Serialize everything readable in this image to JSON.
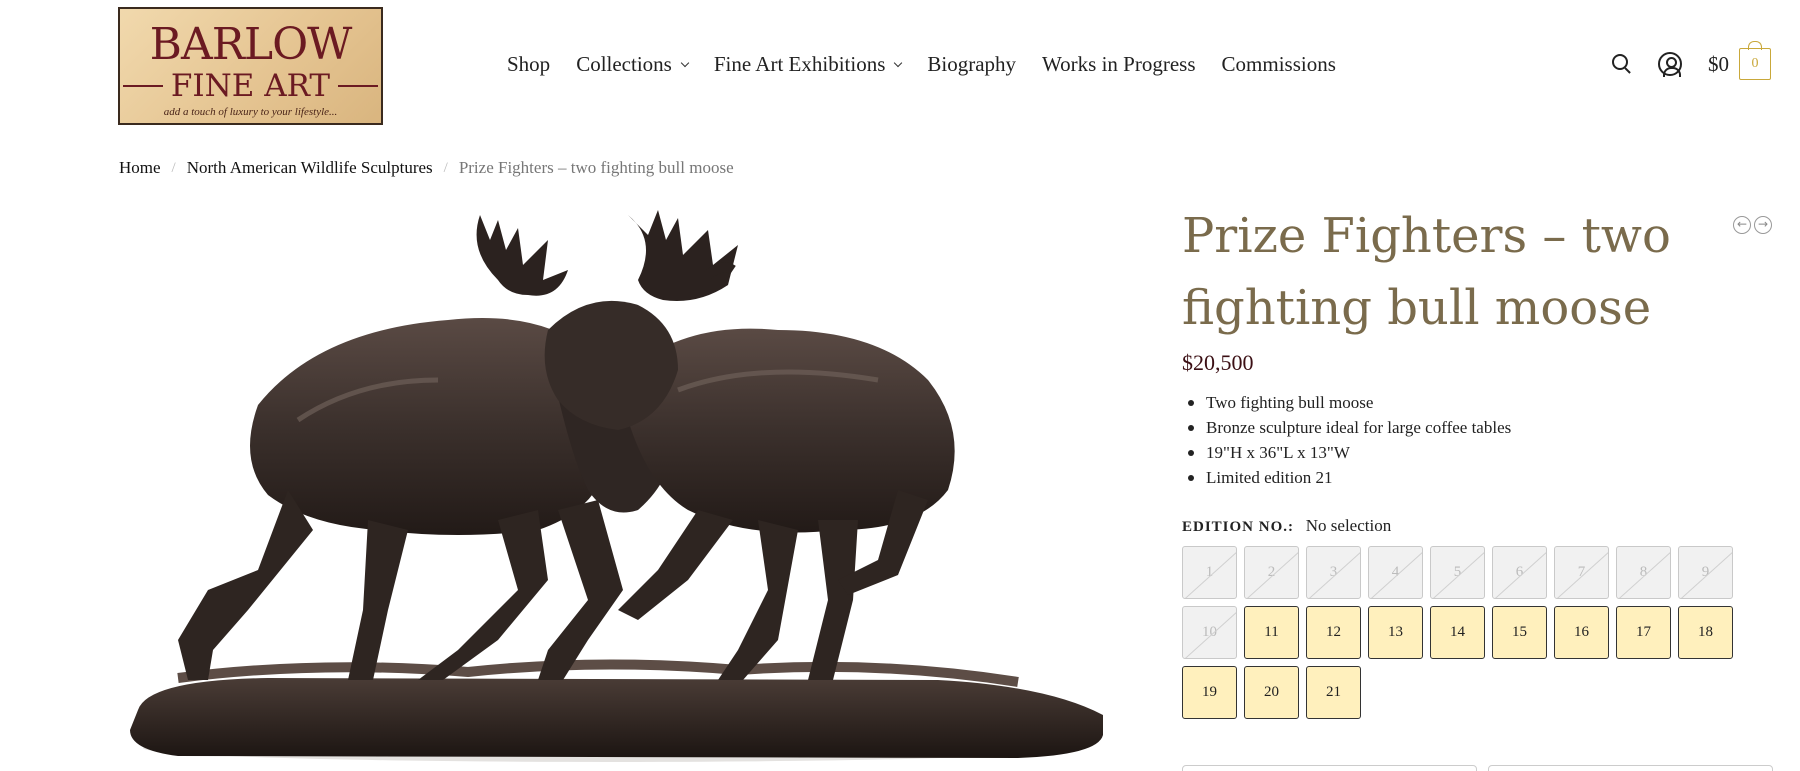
{
  "logo": {
    "line1": "BARLOW",
    "line2": "FINE ART",
    "tagline": "add a touch of luxury to your lifestyle..."
  },
  "nav": {
    "items": [
      {
        "label": "Shop",
        "dropdown": false
      },
      {
        "label": "Collections",
        "dropdown": true
      },
      {
        "label": "Fine Art Exhibitions",
        "dropdown": true
      },
      {
        "label": "Biography",
        "dropdown": false
      },
      {
        "label": "Works in Progress",
        "dropdown": false
      },
      {
        "label": "Commissions",
        "dropdown": false
      }
    ]
  },
  "header_icons": {
    "search": "search-icon",
    "account": "account-icon",
    "cart_total": "$0",
    "cart_count": "0"
  },
  "breadcrumb": {
    "items": [
      "Home",
      "North American Wildlife Sculptures",
      "Prize Fighters – two fighting bull moose"
    ],
    "separator": "/"
  },
  "product": {
    "title": "Prize Fighters – two fighting bull moose",
    "price": "$20,500",
    "features": [
      "Two fighting bull moose",
      "Bronze sculpture ideal for large coffee tables",
      "19\"H x 36\"L x 13\"W",
      "Limited edition 21"
    ],
    "edition_label": "EDITION NO.:",
    "edition_value": "No selection",
    "editions": [
      {
        "n": "1",
        "available": false
      },
      {
        "n": "2",
        "available": false
      },
      {
        "n": "3",
        "available": false
      },
      {
        "n": "4",
        "available": false
      },
      {
        "n": "5",
        "available": false
      },
      {
        "n": "6",
        "available": false
      },
      {
        "n": "7",
        "available": false
      },
      {
        "n": "8",
        "available": false
      },
      {
        "n": "9",
        "available": false
      },
      {
        "n": "10",
        "available": false
      },
      {
        "n": "11",
        "available": true
      },
      {
        "n": "12",
        "available": true
      },
      {
        "n": "13",
        "available": true
      },
      {
        "n": "14",
        "available": true
      },
      {
        "n": "15",
        "available": true
      },
      {
        "n": "16",
        "available": true
      },
      {
        "n": "17",
        "available": true
      },
      {
        "n": "18",
        "available": true
      },
      {
        "n": "19",
        "available": true
      },
      {
        "n": "20",
        "available": true
      },
      {
        "n": "21",
        "available": true
      }
    ]
  },
  "colors": {
    "title": "#7a6b4c",
    "price": "#3b0f14",
    "available_swatch": "#fff0bd",
    "cart_accent": "#c9a83a",
    "logo_text": "#6b1a22"
  }
}
